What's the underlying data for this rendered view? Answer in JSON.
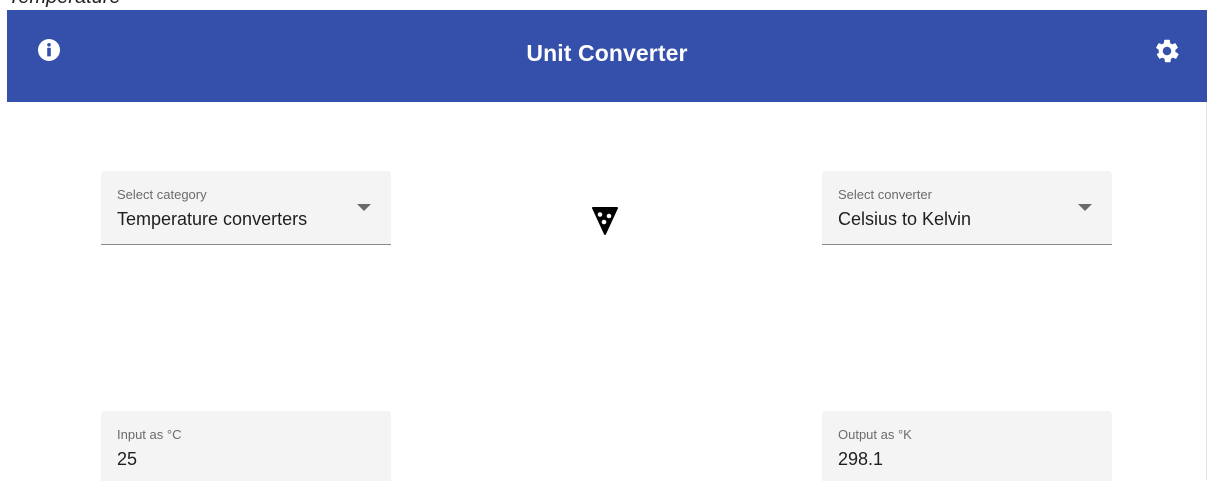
{
  "page_heading": "Temperature",
  "appbar": {
    "title": "Unit Converter",
    "info_icon": "info-icon",
    "settings_icon": "gear-icon",
    "color": "#3550ab"
  },
  "category_select": {
    "label": "Select category",
    "value": "Temperature converters"
  },
  "converter_select": {
    "label": "Select converter",
    "value": "Celsius to Kelvin"
  },
  "swap_icon": "swap-icon",
  "input": {
    "label": "Input as °C",
    "value": "25"
  },
  "output": {
    "label": "Output as °K",
    "value": "298.1"
  }
}
